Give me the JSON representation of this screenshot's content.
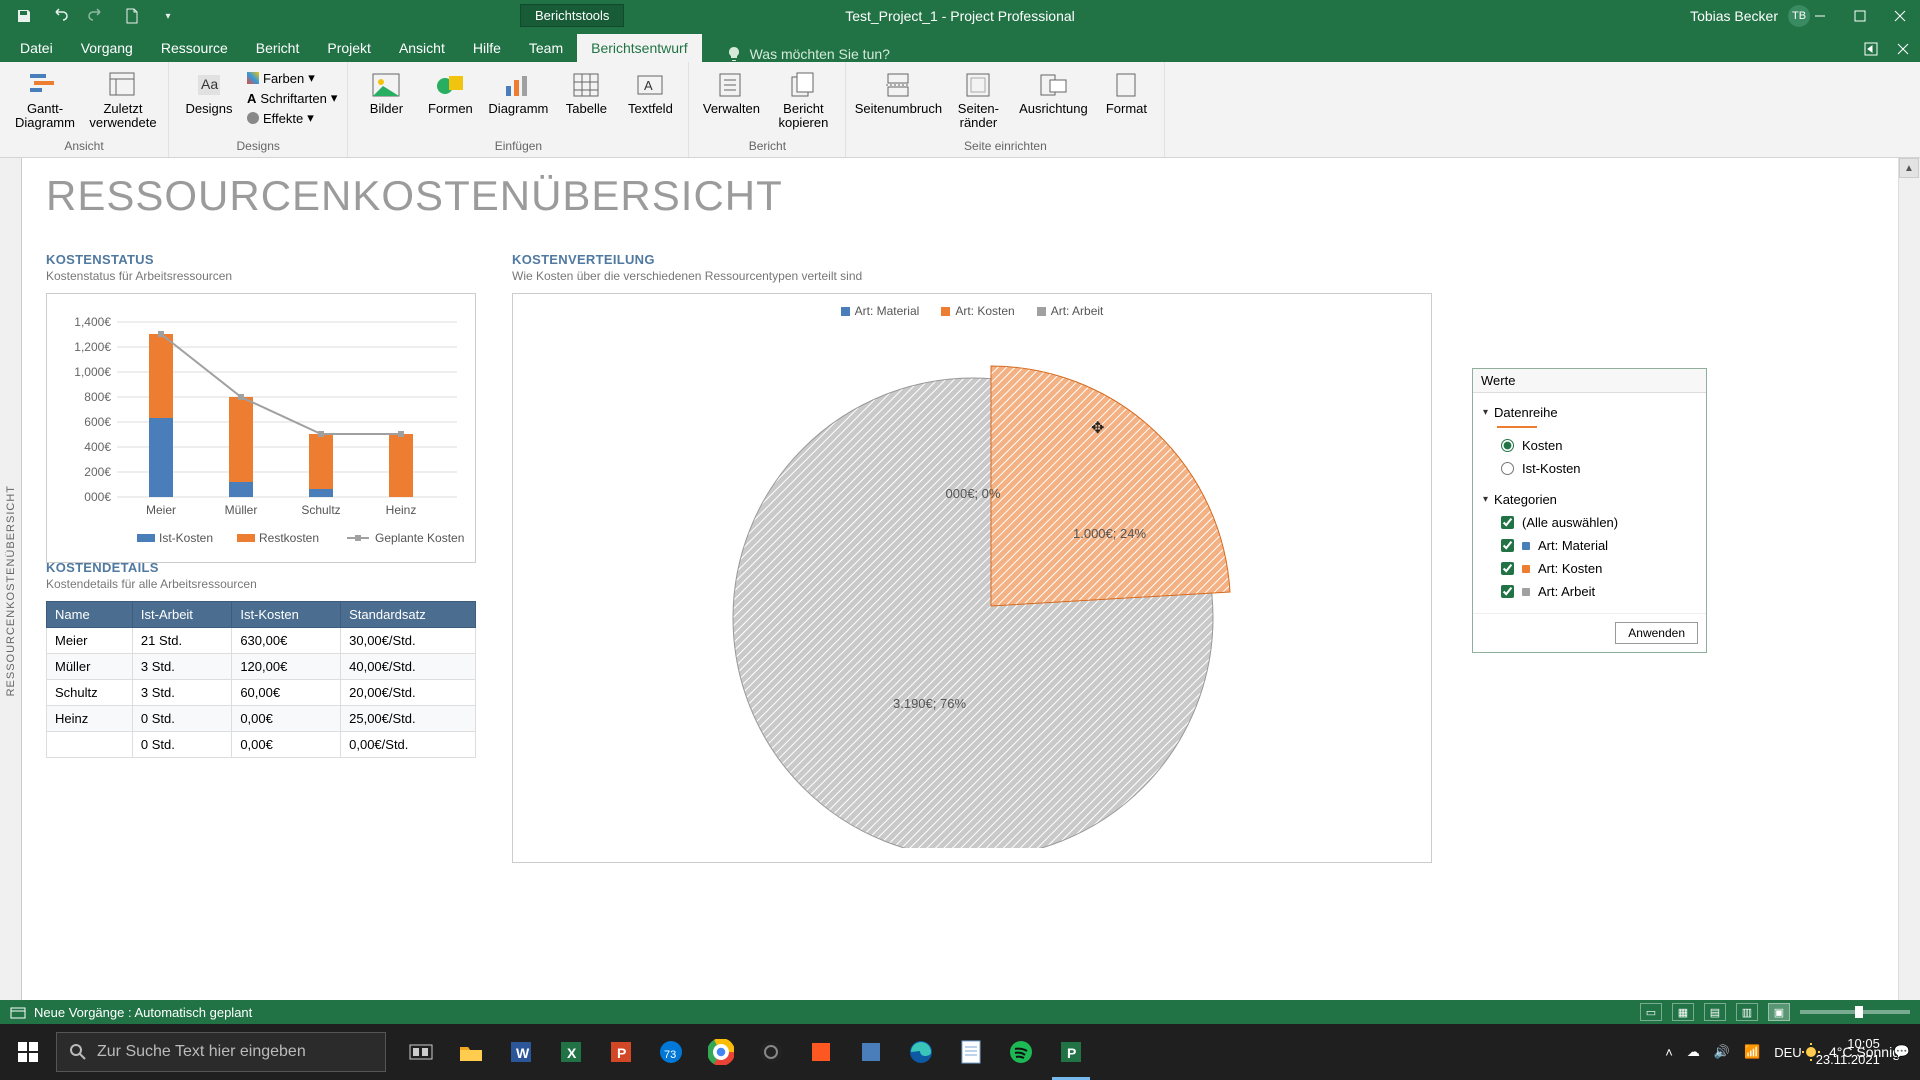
{
  "app": {
    "user_name": "Tobias Becker",
    "user_initials": "TB",
    "title": "Test_Project_1  -  Project Professional",
    "tool_tab": "Berichtstools"
  },
  "tabs": [
    "Datei",
    "Vorgang",
    "Ressource",
    "Bericht",
    "Projekt",
    "Ansicht",
    "Hilfe",
    "Team",
    "Berichtsentwurf"
  ],
  "active_tab": "Berichtsentwurf",
  "search_prompt": "Was möchten Sie tun?",
  "ribbon": {
    "groups": {
      "ansicht": {
        "label": "Ansicht",
        "btn1": "Gantt-Diagramm",
        "btn2": "Zuletzt verwendete"
      },
      "designs": {
        "label": "Designs",
        "btn": "Designs",
        "farben": "Farben",
        "schrift": "Schriftarten",
        "effekte": "Effekte"
      },
      "einfuegen": {
        "label": "Einfügen",
        "bilder": "Bilder",
        "formen": "Formen",
        "diagramm": "Diagramm",
        "tabelle": "Tabelle",
        "textfeld": "Textfeld"
      },
      "bericht": {
        "label": "Bericht",
        "verwalten": "Verwalten",
        "kopieren": "Bericht kopieren"
      },
      "seite": {
        "label": "Seite einrichten",
        "umbruch": "Seitenumbruch",
        "raender": "Seiten-ränder",
        "ausrichtung": "Ausrichtung",
        "format": "Format"
      }
    }
  },
  "report": {
    "title": "RESSOURCENKOSTENÜBERSICHT",
    "side_tab": "RESSOURCENKOSTENÜBERSICHT",
    "status": {
      "title": "KOSTENSTATUS",
      "sub": "Kostenstatus für Arbeitsressourcen",
      "legend": [
        "Ist-Kosten",
        "Restkosten",
        "Geplante Kosten"
      ]
    },
    "details": {
      "title": "KOSTENDETAILS",
      "sub": "Kostendetails für alle Arbeitsressourcen",
      "cols": [
        "Name",
        "Ist-Arbeit",
        "Ist-Kosten",
        "Standardsatz"
      ]
    },
    "dist": {
      "title": "KOSTENVERTEILUNG",
      "sub": "Wie Kosten über die verschiedenen Ressourcentypen verteilt sind",
      "legend": [
        "Art: Material",
        "Art: Kosten",
        "Art: Arbeit"
      ]
    }
  },
  "table_rows": [
    {
      "name": "Meier",
      "arbeit": "21 Std.",
      "kosten": "630,00€",
      "satz": "30,00€/Std."
    },
    {
      "name": "Müller",
      "arbeit": "3 Std.",
      "kosten": "120,00€",
      "satz": "40,00€/Std."
    },
    {
      "name": "Schultz",
      "arbeit": "3 Std.",
      "kosten": "60,00€",
      "satz": "20,00€/Std."
    },
    {
      "name": "Heinz",
      "arbeit": "0 Std.",
      "kosten": "0,00€",
      "satz": "25,00€/Std."
    },
    {
      "name": "",
      "arbeit": "0 Std.",
      "kosten": "0,00€",
      "satz": "0,00€/Std."
    }
  ],
  "pie_labels": {
    "material": "000€; 0%",
    "kosten": "1.000€; 24%",
    "arbeit": "3.190€; 76%"
  },
  "chart_data": [
    {
      "type": "bar",
      "title": "Kostenstatus",
      "categories": [
        "Meier",
        "Müller",
        "Schultz",
        "Heinz"
      ],
      "series": [
        {
          "name": "Ist-Kosten",
          "values": [
            630,
            120,
            60,
            0
          ],
          "color": "#4a7ebb"
        },
        {
          "name": "Restkosten",
          "values": [
            670,
            680,
            440,
            500
          ],
          "color": "#ed7d31"
        },
        {
          "name": "Geplante Kosten",
          "values": [
            1300,
            800,
            500,
            500
          ],
          "color": "#a0a0a0",
          "type": "line"
        }
      ],
      "ylabel": "€",
      "ylim": [
        0,
        1400
      ],
      "yticks": [
        "000€",
        "200€",
        "400€",
        "600€",
        "800€",
        "1,000€",
        "1,200€",
        "1,400€"
      ]
    },
    {
      "type": "pie",
      "title": "Kostenverteilung",
      "series": [
        {
          "name": "Art: Material",
          "value": 0,
          "pct": 0,
          "color": "#4a7ebb"
        },
        {
          "name": "Art: Kosten",
          "value": 1000,
          "pct": 24,
          "color": "#ed7d31"
        },
        {
          "name": "Art: Arbeit",
          "value": 3190,
          "pct": 76,
          "color": "#a0a0a0"
        }
      ]
    }
  ],
  "field_pane": {
    "title": "Werte",
    "datenreihe": "Datenreihe",
    "kosten": "Kosten",
    "istkosten": "Ist-Kosten",
    "kategorien": "Kategorien",
    "alle": "(Alle auswählen)",
    "mat": "Art: Material",
    "kos": "Art: Kosten",
    "arb": "Art: Arbeit",
    "apply": "Anwenden"
  },
  "statusbar": {
    "msg": "Neue Vorgänge : Automatisch geplant"
  },
  "taskbar": {
    "search_placeholder": "Zur Suche Text hier eingeben",
    "weather": "4°C  Sonnig",
    "lang": "DEU",
    "time": "10:05",
    "date": "23.11.2021"
  },
  "colors": {
    "blue": "#4a7ebb",
    "orange": "#ed7d31",
    "gray": "#a0a0a0",
    "green": "#217346"
  }
}
